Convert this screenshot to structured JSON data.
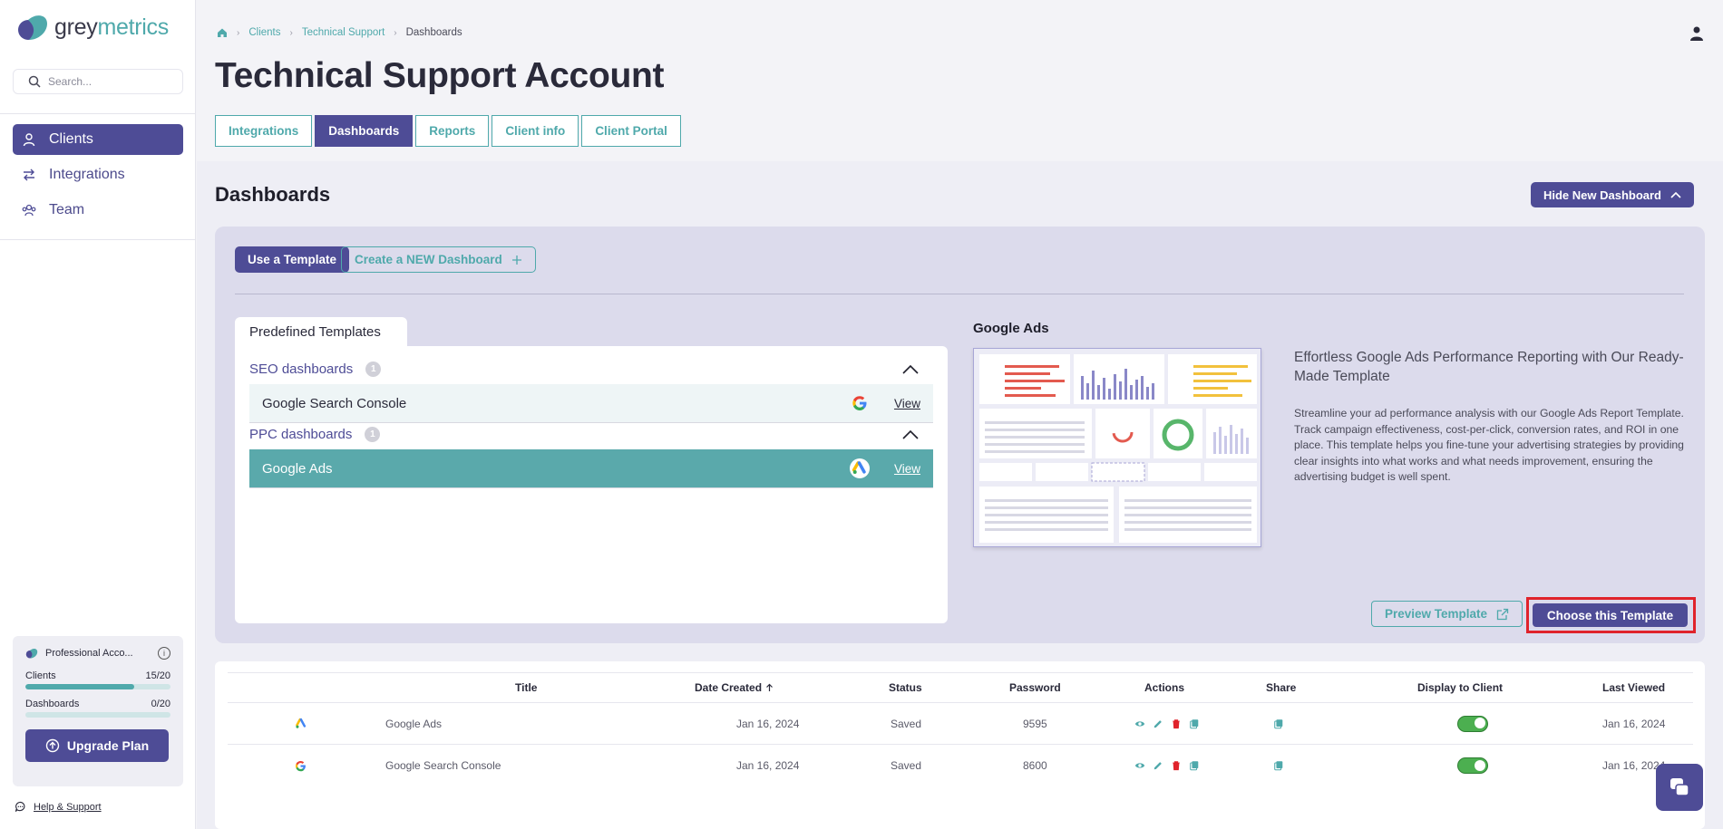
{
  "brand": {
    "name_part1": "grey",
    "name_part2": "metrics"
  },
  "search": {
    "placeholder": "Search..."
  },
  "nav": {
    "items": [
      {
        "label": "Clients"
      },
      {
        "label": "Integrations"
      },
      {
        "label": "Team"
      }
    ]
  },
  "plan": {
    "name": "Professional Acco...",
    "clients_label": "Clients",
    "clients_value": "15/20",
    "clients_fraction": 0.75,
    "dashboards_label": "Dashboards",
    "dashboards_value": "0/20",
    "dashboards_fraction": 0.0,
    "upgrade_label": "Upgrade Plan"
  },
  "help": {
    "label": "Help & Support"
  },
  "breadcrumb": {
    "clients": "Clients",
    "support": "Technical Support",
    "current": "Dashboards"
  },
  "page": {
    "title": "Technical Support Account"
  },
  "tabs": [
    {
      "label": "Integrations"
    },
    {
      "label": "Dashboards"
    },
    {
      "label": "Reports"
    },
    {
      "label": "Client info"
    },
    {
      "label": "Client Portal"
    }
  ],
  "section": {
    "title": "Dashboards",
    "hide_label": "Hide New Dashboard"
  },
  "panel": {
    "use_template": "Use a Template",
    "create_new": "Create a NEW Dashboard",
    "templates_tab": "Predefined Templates",
    "categories": [
      {
        "name": "SEO dashboards",
        "count": "1",
        "templates": [
          {
            "name": "Google Search Console",
            "view": "View"
          }
        ]
      },
      {
        "name": "PPC dashboards",
        "count": "1",
        "templates": [
          {
            "name": "Google Ads",
            "view": "View"
          }
        ]
      }
    ]
  },
  "preview": {
    "title": "Google Ads",
    "heading": "Effortless Google Ads Performance Reporting with Our Ready-Made Template",
    "description": "Streamline your ad performance analysis with our Google Ads Report Template. Track campaign effectiveness, cost-per-click, conversion rates, and ROI in one place. This template helps you fine-tune your advertising strategies by providing clear insights into what works and what needs improvement, ensuring the advertising budget is well spent.",
    "preview_btn": "Preview Template",
    "choose_btn": "Choose this Template"
  },
  "table": {
    "headers": {
      "title": "Title",
      "date": "Date Created",
      "status": "Status",
      "password": "Password",
      "actions": "Actions",
      "share": "Share",
      "display": "Display to Client",
      "last": "Last Viewed"
    },
    "rows": [
      {
        "title": "Google Ads",
        "date": "Jan 16, 2024",
        "status": "Saved",
        "password": "9595",
        "last": "Jan 16, 2024",
        "display": true
      },
      {
        "title": "Google Search Console",
        "date": "Jan 16, 2024",
        "status": "Saved",
        "password": "8600",
        "last": "Jan 16, 2024",
        "display": true
      }
    ]
  },
  "colors": {
    "primary": "#4e4c96",
    "teal": "#4fa9ab",
    "highlight": "#e0232b"
  }
}
